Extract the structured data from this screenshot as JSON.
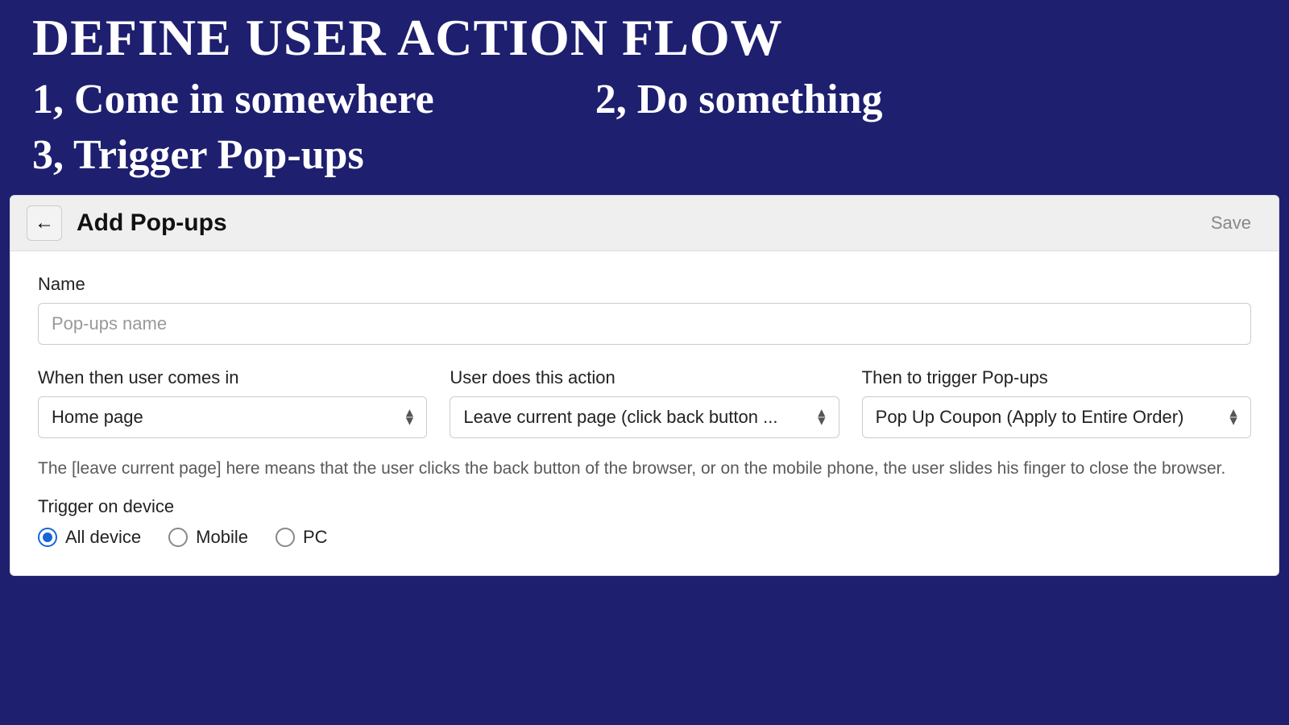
{
  "slide": {
    "title": "DEFINE USER ACTION FLOW",
    "step1": "1,  Come in somewhere",
    "step2": "2, Do something",
    "step3": "3, Trigger Pop-ups"
  },
  "panel": {
    "back_icon": "←",
    "title": "Add Pop-ups",
    "save_label": "Save"
  },
  "form": {
    "name_label": "Name",
    "name_placeholder": "Pop-ups name",
    "name_value": "",
    "when_label": "When then user comes in",
    "when_value": "Home page",
    "action_label": "User does this action",
    "action_value": "Leave current page (click back button ...",
    "trigger_label": "Then to trigger Pop-ups",
    "trigger_value": "Pop Up Coupon (Apply to Entire Order)",
    "help_text": "The [leave current page] here means that the user clicks the back button of the browser, or on the mobile phone, the user slides his finger to close the browser.",
    "device_label": "Trigger on device",
    "device_options": {
      "all": "All device",
      "mobile": "Mobile",
      "pc": "PC"
    },
    "device_selected": "all"
  }
}
